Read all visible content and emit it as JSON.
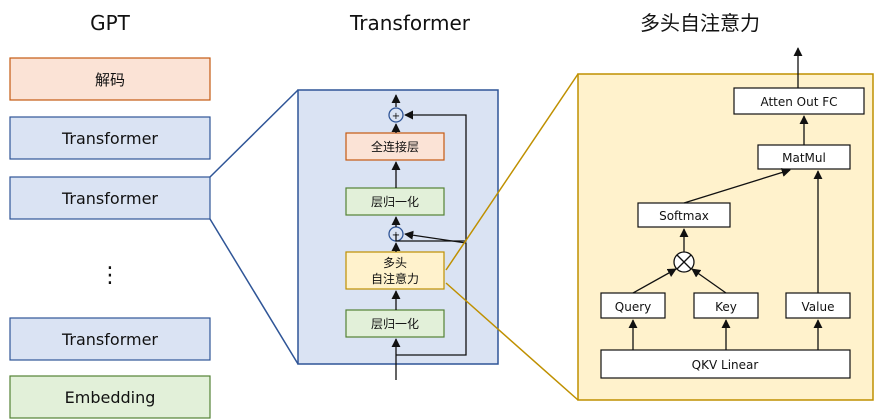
{
  "headings": {
    "gpt": "GPT",
    "transformer": "Transformer",
    "mha": "多头自注意力"
  },
  "gpt_stack": {
    "decode": "解码",
    "transformer_1": "Transformer",
    "transformer_2": "Transformer",
    "ellipsis": "⋮",
    "transformer_last": "Transformer",
    "embedding": "Embedding"
  },
  "transformer_block": {
    "fc": "全连接层",
    "norm_top": "层归一化",
    "mha_line1": "多头",
    "mha_line2": "自注意力",
    "norm_bottom": "层归一化",
    "add_symbol": "+"
  },
  "attention_block": {
    "atten_out": "Atten Out FC",
    "matmul": "MatMul",
    "softmax": "Softmax",
    "query": "Query",
    "key": "Key",
    "value": "Value",
    "qkv": "QKV Linear"
  },
  "colors": {
    "decode_fill": "#fbe3d6",
    "decode_stroke": "#c55a11",
    "blue_fill": "#dae3f3",
    "blue_stroke": "#2f5597",
    "green_fill": "#e2f0d9",
    "green_stroke": "#548235",
    "yellow_fill": "#fff2cc",
    "yellow_stroke": "#bf9000",
    "panel_blue": "#dae3f3",
    "panel_yellow": "#fff2cc"
  }
}
